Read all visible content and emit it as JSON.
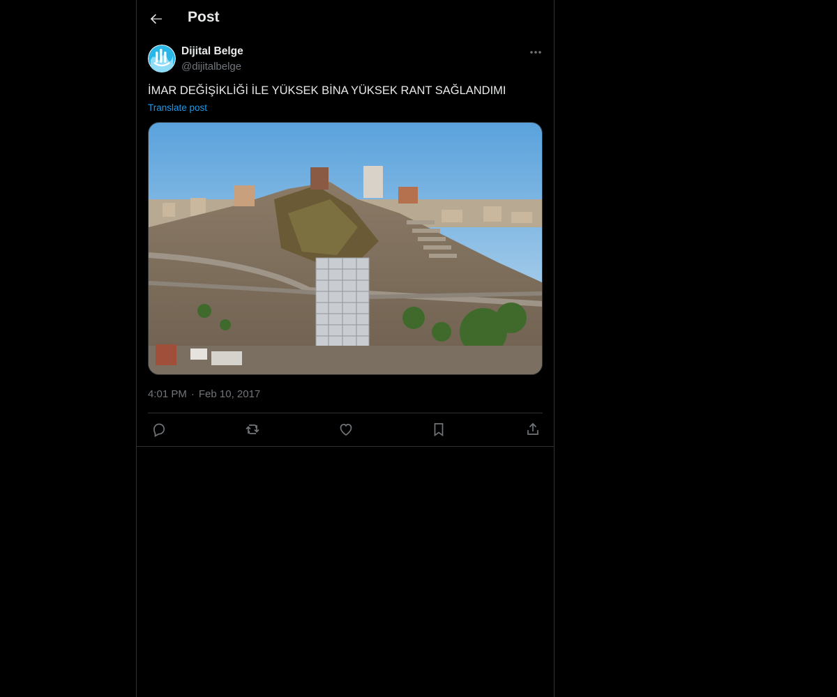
{
  "header": {
    "title": "Post",
    "back_icon": "arrow-left-icon"
  },
  "post": {
    "author": {
      "name": "Dijital Belge",
      "handle": "@dijitalbelge",
      "avatar_icon": "dijital-belge-logo"
    },
    "text": "İMAR DEĞİŞİKLİĞİ İLE YÜKSEK BİNA YÜKSEK RANT SAĞLANDIMI",
    "translate_label": "Translate post",
    "time": "4:01 PM",
    "separator": "·",
    "date": "Feb 10, 2017",
    "media_icon": "photo-city-hillside"
  },
  "actions": [
    {
      "icon": "reply-icon"
    },
    {
      "icon": "repost-icon"
    },
    {
      "icon": "like-icon"
    },
    {
      "icon": "bookmark-icon"
    },
    {
      "icon": "share-icon"
    }
  ],
  "colors": {
    "background": "#000000",
    "text": "#e7e9ea",
    "secondary": "#71767b",
    "link": "#1d9bf0",
    "border": "#2f3336"
  }
}
